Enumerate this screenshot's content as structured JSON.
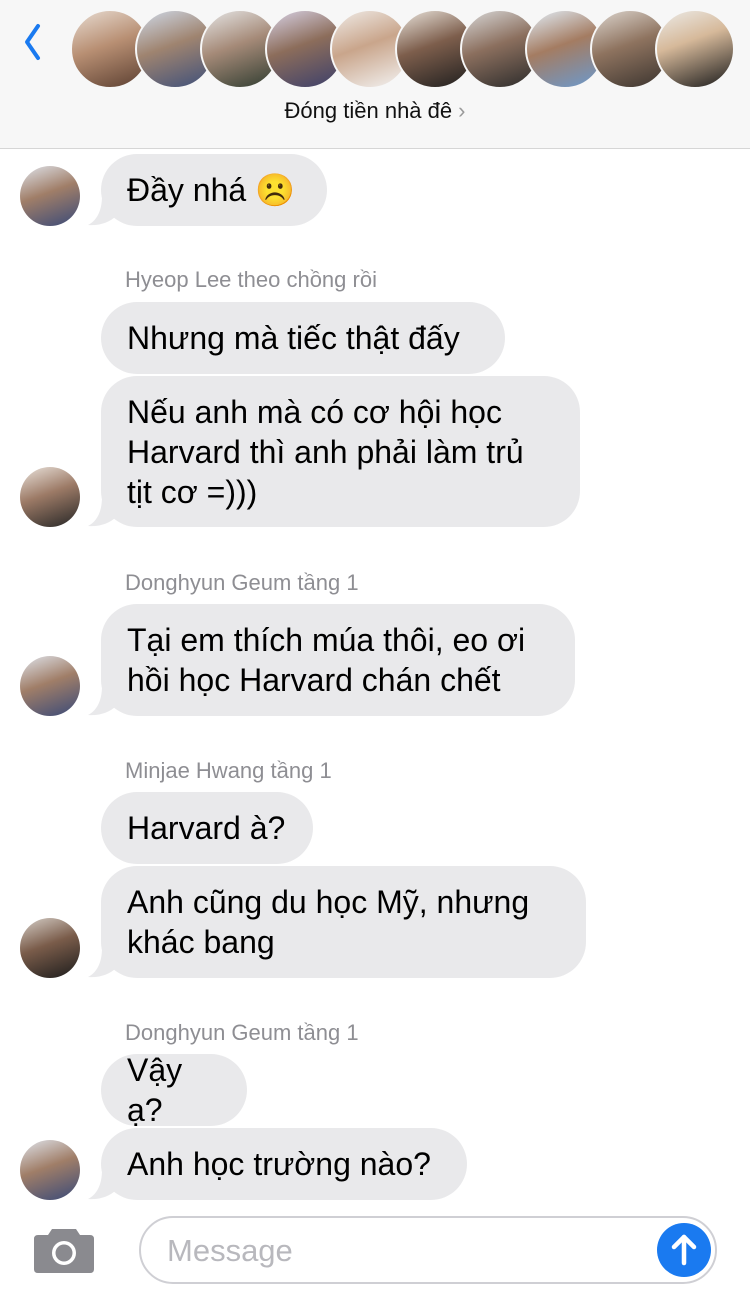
{
  "header": {
    "group_name": "Đóng tiền nhà đê",
    "chevron": "›",
    "member_avatars": [
      "avatar-1",
      "avatar-2",
      "avatar-3",
      "avatar-4",
      "avatar-5",
      "avatar-6",
      "avatar-7",
      "avatar-8",
      "avatar-9",
      "avatar-10"
    ]
  },
  "messages": [
    {
      "text": "Đầy nhá ☹️"
    },
    {
      "sender": "Hyeop Lee theo chồng rồi"
    },
    {
      "text": "Nhưng mà tiếc thật đấy"
    },
    {
      "text_lines": [
        "Nếu anh mà có cơ hội học",
        "Harvard thì anh phải làm trủ",
        "tịt cơ =)))"
      ]
    },
    {
      "sender": "Donghyun Geum tầng 1"
    },
    {
      "text_lines": [
        "Tại em thích múa thôi, eo ơi",
        "hồi học Harvard chán chết"
      ]
    },
    {
      "sender": "Minjae Hwang tầng 1"
    },
    {
      "text": "Harvard à?"
    },
    {
      "text_lines": [
        "Anh cũng du học Mỹ, nhưng",
        "khác bang"
      ]
    },
    {
      "sender": "Donghyun Geum tầng 1"
    },
    {
      "text": "Vậy ạ?"
    },
    {
      "text": "Anh học trường nào?"
    }
  ],
  "input": {
    "placeholder": "Message",
    "value": ""
  },
  "colors": {
    "bubble": "#e9e9eb",
    "accent": "#1a7af0",
    "sender_text": "#8e8e93",
    "header_bg": "#f7f7f7"
  },
  "icons": [
    "back-chevron-icon",
    "camera-icon",
    "send-arrow-icon"
  ]
}
